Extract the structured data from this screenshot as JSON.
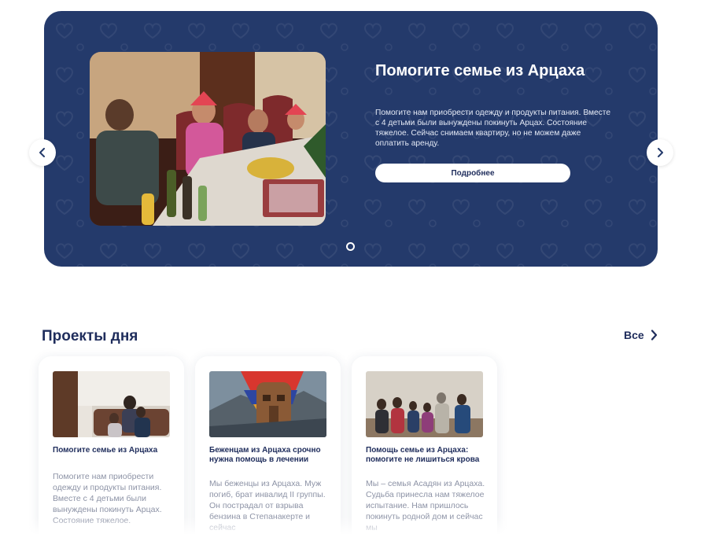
{
  "hero": {
    "title": "Помогите семье из Арцаха",
    "description": "Помогите нам приобрести одежду и продукты питания. Вместе с 4 детьми были вынуждены покинуть Арцах. Состояние тяжелое. Сейчас снимаем квартиру, но не можем даже оплатить аренду.",
    "button_label": "Подробнее",
    "slide_count": 1,
    "active_slide": 1
  },
  "projects": {
    "title": "Проекты дня",
    "see_all_label": "Все",
    "cards": [
      {
        "title": "Помогите семье из Арцаха",
        "description": "Помогите нам приобрести одежду и продукты питания. Вместе с 4 детьми были вынуждены покинуть  Арцах. Состояние тяжелое."
      },
      {
        "title": "Беженцам из Арцаха срочно нужна помощь в лечении",
        "description": "Мы беженцы из Арцаха. Муж погиб, брат инвалид II группы. Он пострадал от взрыва бензина в Степанакерте и сейчас"
      },
      {
        "title": "Помощь семье из Арцаха: помогите не лишиться крова",
        "description": "Мы – семья Асадян из Арцаха. Судьба принесла нам тяжелое испытание. Нам пришлось покинуть родной дом и сейчас мы"
      }
    ]
  },
  "colors": {
    "brand_navy": "#243a6b",
    "heading": "#1f2d5c",
    "muted_text": "#8d93a6"
  },
  "icons": {
    "prev": "chevron-left-icon",
    "next": "chevron-right-icon",
    "see_all": "chevron-right-icon"
  }
}
